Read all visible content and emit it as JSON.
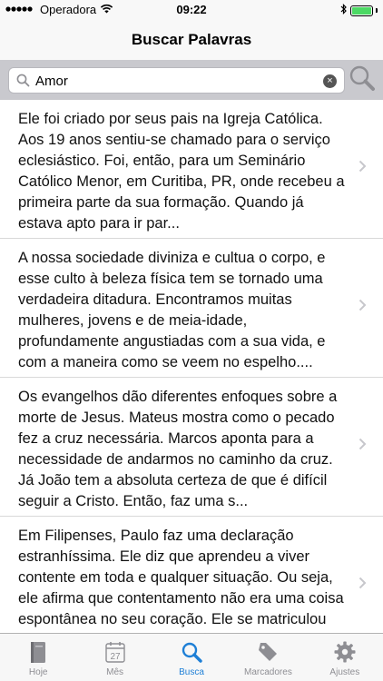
{
  "status_bar": {
    "carrier": "Operadora",
    "time": "09:22",
    "wifi_icon": "wifi-icon",
    "battery_icon": "battery-icon",
    "battery_level": 1.0
  },
  "nav": {
    "title": "Buscar Palavras"
  },
  "search": {
    "value": "Amor",
    "placeholder": "",
    "search_icon": "magnifier-icon",
    "clear_icon": "clear-icon"
  },
  "results": [
    {
      "text": "Ele foi criado por seus pais na Igreja Católica. Aos 19 anos sentiu-se chamado para o serviço eclesiástico. Foi, então,  para um Seminário Católico Menor, em Curitiba, PR, onde recebeu a primeira parte da sua formação.  Quando já estava apto para ir par..."
    },
    {
      "text": "A nossa sociedade diviniza e cultua o corpo, e esse culto à beleza física tem se tornado uma verdadeira ditadura. Encontramos muitas mulheres, jovens e de meia-idade, profundamente angustiadas com a sua vida, e com a maneira como se veem no espelho...."
    },
    {
      "text": "Os evangelhos dão diferentes enfoques sobre a morte de Jesus. Mateus mostra como o pecado fez a cruz necessária. Marcos aponta para a necessidade de andarmos no caminho da cruz. Já João tem a absoluta certeza de que é difícil seguir a Cristo. Então, faz uma s..."
    },
    {
      "text": "Em Filipenses, Paulo faz uma declaração estranhíssima. Ele diz que aprendeu a viver contente em toda e qualquer situação. Ou seja, ele afirma que contentamento não era uma coisa espontânea no seu coração. Ele se matriculou na “Escola do Contentamento”. P..."
    }
  ],
  "tabs": [
    {
      "label": "Hoje",
      "icon": "book-icon",
      "active": false
    },
    {
      "label": "Mês",
      "icon": "calendar-icon",
      "calendar_day": "27",
      "active": false
    },
    {
      "label": "Busca",
      "icon": "search-icon",
      "active": true
    },
    {
      "label": "Marcadores",
      "icon": "bookmark-icon",
      "active": false
    },
    {
      "label": "Ajustes",
      "icon": "gear-icon",
      "active": false
    }
  ],
  "colors": {
    "accent": "#1e7fd6",
    "inactive": "#8e8e93",
    "search_bar_bg": "#c9c9ce"
  }
}
